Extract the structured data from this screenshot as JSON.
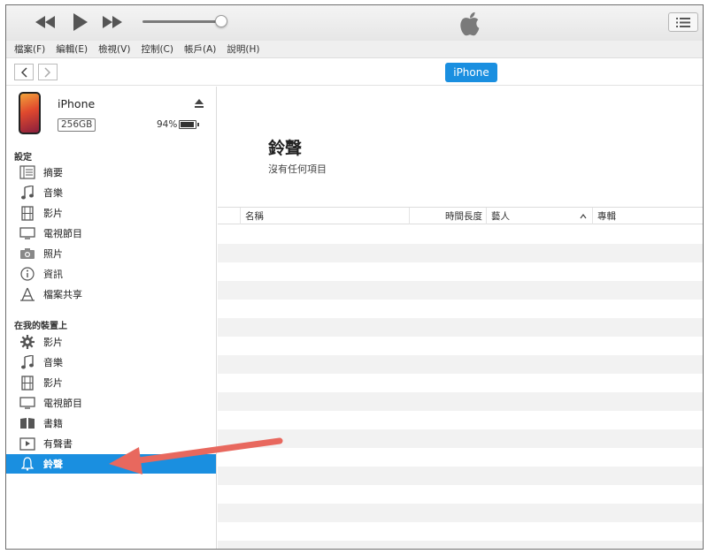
{
  "menu": [
    "檔案(F)",
    "編輯(E)",
    "檢視(V)",
    "控制(C)",
    "帳戶(A)",
    "說明(H)"
  ],
  "player": {
    "volume": 0.92
  },
  "nav": {
    "device_label": "iPhone"
  },
  "device": {
    "name": "iPhone",
    "capacity": "256GB",
    "battery": "94%"
  },
  "sidebar": {
    "settings_title": "設定",
    "settings_items": [
      {
        "label": "摘要",
        "icon": "summary-icon"
      },
      {
        "label": "音樂",
        "icon": "music-icon"
      },
      {
        "label": "影片",
        "icon": "film-icon"
      },
      {
        "label": "電視節目",
        "icon": "tv-icon"
      },
      {
        "label": "照片",
        "icon": "camera-icon"
      },
      {
        "label": "資訊",
        "icon": "info-icon"
      },
      {
        "label": "檔案共享",
        "icon": "file-sharing-icon"
      }
    ],
    "ondevice_title": "在我的裝置上",
    "ondevice_items": [
      {
        "label": "影片",
        "icon": "gear-icon"
      },
      {
        "label": "音樂",
        "icon": "music-icon"
      },
      {
        "label": "影片",
        "icon": "film-icon"
      },
      {
        "label": "電視節目",
        "icon": "tv-icon"
      },
      {
        "label": "書籍",
        "icon": "book-icon"
      },
      {
        "label": "有聲書",
        "icon": "audiobook-icon"
      },
      {
        "label": "鈴聲",
        "icon": "bell-icon",
        "selected": true
      }
    ]
  },
  "main": {
    "title": "鈴聲",
    "subtitle": "沒有任何項目",
    "columns": [
      "名稱",
      "時間長度",
      "藝人",
      "專輯"
    ]
  },
  "colors": {
    "accent": "#1a8fe0",
    "annotation_arrow": "#e8685e"
  }
}
